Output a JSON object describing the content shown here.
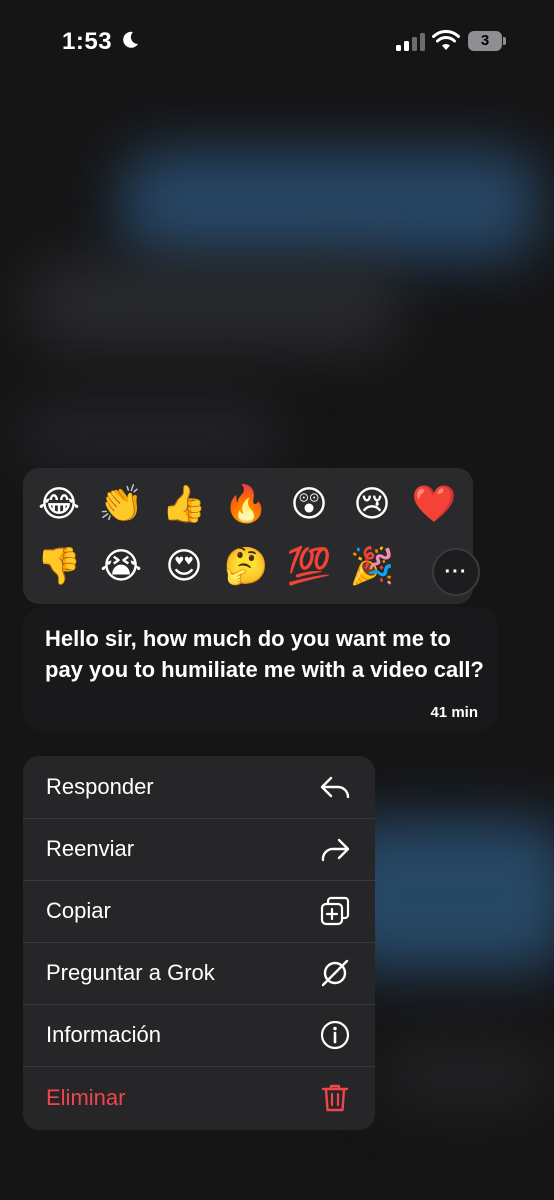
{
  "status_bar": {
    "time": "1:53",
    "battery": "3"
  },
  "reactions": {
    "row1": [
      "😂",
      "👏",
      "👍",
      "🔥",
      "😲",
      "😢",
      "❤️"
    ],
    "row2": [
      "👎",
      "😭",
      "😍",
      "🤔",
      "💯",
      "🎉"
    ],
    "more_label": "···"
  },
  "message": {
    "text": "Hello sir, how much do you want me to pay you to humiliate me with a video call?",
    "time": "41 min"
  },
  "menu": {
    "items": [
      {
        "label": "Responder",
        "icon": "reply-icon"
      },
      {
        "label": "Reenviar",
        "icon": "forward-icon"
      },
      {
        "label": "Copiar",
        "icon": "copy-icon"
      },
      {
        "label": "Preguntar a Grok",
        "icon": "grok-icon"
      },
      {
        "label": "Información",
        "icon": "info-icon"
      },
      {
        "label": "Eliminar",
        "icon": "trash-icon"
      }
    ]
  },
  "colors": {
    "danger": "#f0464b",
    "menu_bg": "#262629"
  }
}
